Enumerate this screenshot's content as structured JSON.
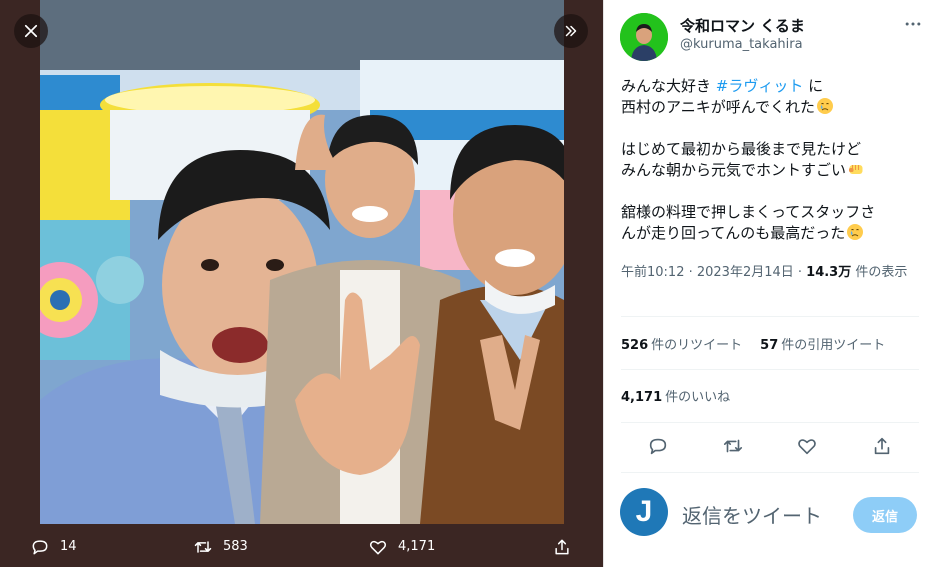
{
  "viewer": {
    "actions": {
      "reply_count": "14",
      "retweet_count": "583",
      "like_count": "4,171"
    }
  },
  "tweet": {
    "author_name": "令和ロマン くるま",
    "author_handle": "@kuruma_takahira",
    "lines": {
      "l1_pre": "みんな大好き ",
      "hashtag": "#ラヴィット",
      "l1_post": " に",
      "l2": "西村のアニキが呼んでくれた",
      "l3": "はじめて最初から最後まで見たけど",
      "l4": "みんな朝から元気でホントすごい",
      "l5": "舘様の料理で押しまくってスタッフさ",
      "l6": "んが走り回ってんのも最高だった"
    },
    "emoji": {
      "crying": "crying-face-emoji",
      "fist": "fist-emoji"
    },
    "meta": {
      "datetime": "午前10:12 · 2023年2月14日 · ",
      "views_count": "14.3万",
      "views_label": " 件の表示"
    },
    "stats": {
      "retweets_count": "526",
      "retweets_label": "件のリツイート",
      "quotes_count": "57",
      "quotes_label": "件の引用ツイート",
      "likes_count": "4,171",
      "likes_label": "件のいいね"
    },
    "reply": {
      "avatar_letter": "J",
      "placeholder": "返信をツイート",
      "button_label": "返信"
    }
  },
  "colors": {
    "viewer_bg": "#3b2623",
    "accent": "#1d9bf0",
    "reply_button": "#8ecdf7",
    "avatar_bg": "#23c21c"
  },
  "icons": [
    "close-icon",
    "chevron-right-double-icon",
    "reply-icon",
    "retweet-icon",
    "heart-icon",
    "share-icon",
    "more-icon"
  ]
}
